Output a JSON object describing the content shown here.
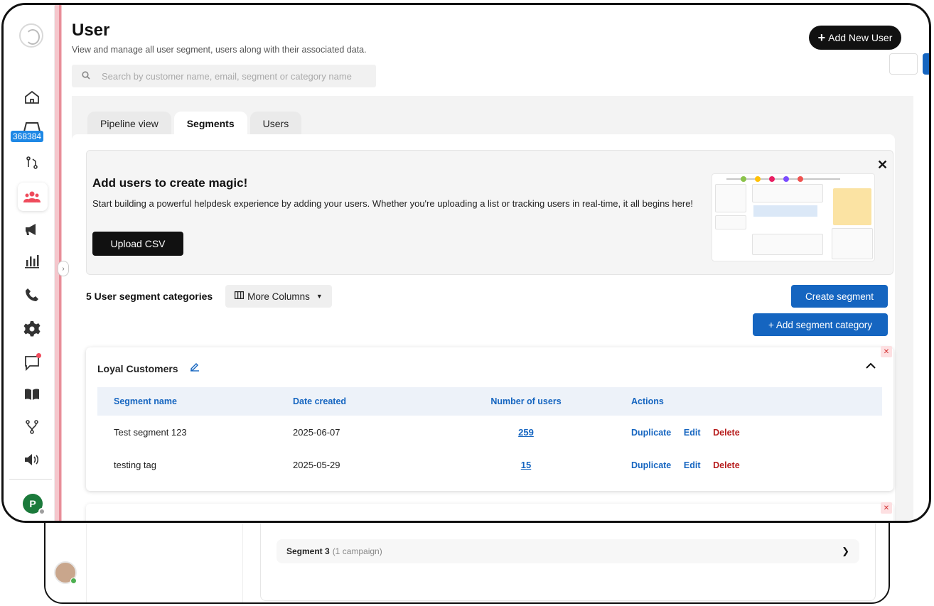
{
  "header": {
    "title": "User",
    "subtitle": "View and manage all user segment, users along with their associated data.",
    "add_user_label": "Add New User",
    "search_placeholder": "Search by customer name, email, segment or category name"
  },
  "sidebar": {
    "badge": "368384",
    "avatar_initial": "P"
  },
  "tabs": [
    {
      "label": "Pipeline view",
      "active": false
    },
    {
      "label": "Segments",
      "active": true
    },
    {
      "label": "Users",
      "active": false
    }
  ],
  "promo": {
    "title": "Add users to create magic!",
    "body": "Start building a powerful helpdesk experience by adding your users. Whether you're uploading a list or tracking users in real-time, it all begins here!",
    "upload_label": "Upload CSV"
  },
  "toolbar": {
    "segment_count_label": "5 User segment categories",
    "more_columns_label": "More Columns",
    "create_segment_label": "Create segment",
    "add_category_label": "+ Add segment category"
  },
  "category": {
    "name": "Loyal Customers",
    "columns": [
      "Segment name",
      "Date created",
      "Number of users",
      "Actions"
    ],
    "rows": [
      {
        "name": "Test segment 123",
        "date": "2025-06-07",
        "users": "259"
      },
      {
        "name": "testing tag",
        "date": "2025-05-29",
        "users": "15"
      }
    ],
    "actions": {
      "duplicate": "Duplicate",
      "edit": "Edit",
      "delete": "Delete"
    }
  },
  "back_window": {
    "segment_label": "Segment 3",
    "segment_meta": "(1 campaign)"
  },
  "colors": {
    "primary": "#1565c0",
    "danger": "#b71c1c",
    "dark": "#111111",
    "avatar_green": "#1b7a3b"
  }
}
